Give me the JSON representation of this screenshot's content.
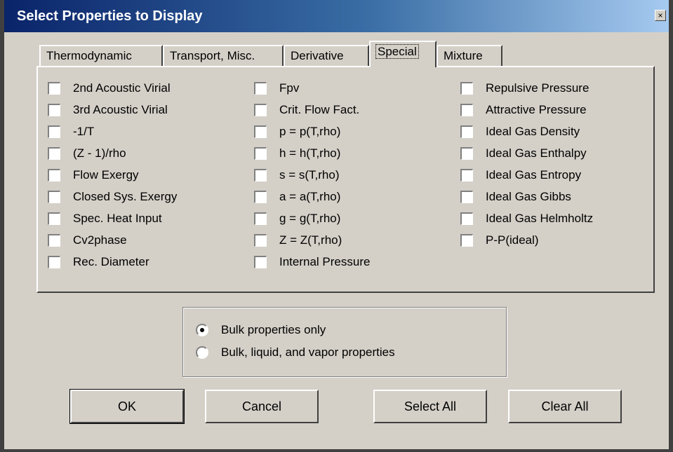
{
  "window": {
    "title": "Select Properties to Display",
    "close_glyph": "×"
  },
  "tabs": [
    {
      "label": "Thermodynamic",
      "active": false
    },
    {
      "label": "Transport, Misc.",
      "active": false
    },
    {
      "label": "Derivative",
      "active": false
    },
    {
      "label": "Special",
      "active": true
    },
    {
      "label": "Mixture",
      "active": false
    }
  ],
  "columns": [
    [
      "2nd Acoustic Virial",
      "3rd Acoustic Virial",
      "-1/T",
      "(Z - 1)/rho",
      "Flow Exergy",
      "Closed Sys. Exergy",
      "Spec. Heat Input",
      "Cv2phase",
      "Rec. Diameter"
    ],
    [
      "Fpv",
      "Crit. Flow Fact.",
      "p = p(T,rho)",
      "h = h(T,rho)",
      "s = s(T,rho)",
      "a = a(T,rho)",
      "g = g(T,rho)",
      "Z = Z(T,rho)",
      "Internal Pressure"
    ],
    [
      "Repulsive Pressure",
      "Attractive Pressure",
      "Ideal Gas Density",
      "Ideal Gas Enthalpy",
      "Ideal Gas Entropy",
      "Ideal Gas Gibbs",
      "Ideal Gas Helmholtz",
      "P-P(ideal)"
    ]
  ],
  "radios": [
    {
      "label": "Bulk properties only",
      "checked": true
    },
    {
      "label": "Bulk, liquid, and vapor properties",
      "checked": false
    }
  ],
  "buttons": {
    "ok": "OK",
    "cancel": "Cancel",
    "select_all": "Select All",
    "clear_all": "Clear All"
  },
  "colors": {
    "face": "#d4d0c8",
    "title_start": "#0a246a",
    "title_end": "#a6caf0"
  }
}
